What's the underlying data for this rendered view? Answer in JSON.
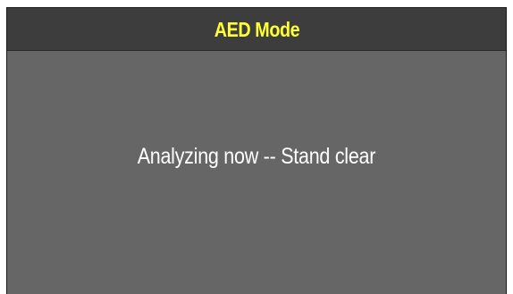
{
  "header": {
    "title": "AED Mode"
  },
  "main": {
    "status_message": "Analyzing now -- Stand clear"
  },
  "colors": {
    "title_text": "#ffff33",
    "title_bar_background": "#3d3d3d",
    "screen_background": "#666666",
    "message_text": "#ffffff"
  }
}
